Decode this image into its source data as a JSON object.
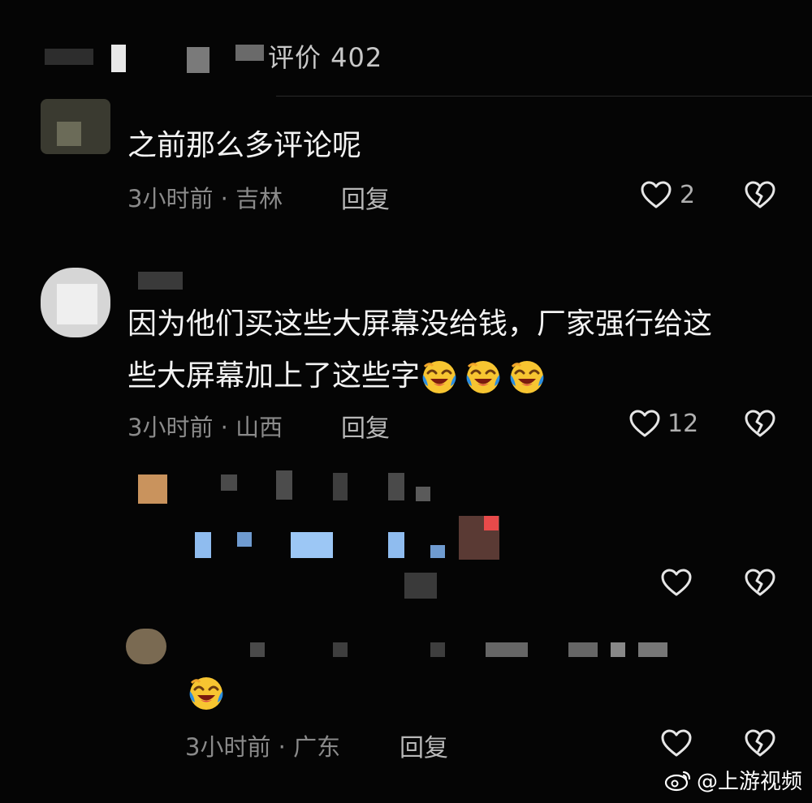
{
  "header": {
    "count_label": "评价 402"
  },
  "comments": [
    {
      "text": "之前那么多评论呢",
      "meta": "3小时前 · 吉林",
      "reply_label": "回复",
      "likes": "2"
    },
    {
      "text_line1": "因为他们买这些大屏幕没给钱，厂家强行给这",
      "text_line2": "些大屏幕加上了这些字",
      "meta": "3小时前 · 山西",
      "reply_label": "回复",
      "likes": "12"
    }
  ],
  "replies": [
    {
      "meta": "",
      "reply_label": ""
    },
    {
      "meta": "3小时前 · 广东",
      "reply_label": "回复"
    }
  ],
  "icons": {
    "like": "heart-outline-icon",
    "dislike": "broken-heart-icon",
    "emoji": "laugh-cry-emoji"
  },
  "watermark": {
    "text": "@上游视频"
  },
  "colors": {
    "background": "#050505",
    "text": "#f3f3f3",
    "meta": "#8a8a8a"
  }
}
